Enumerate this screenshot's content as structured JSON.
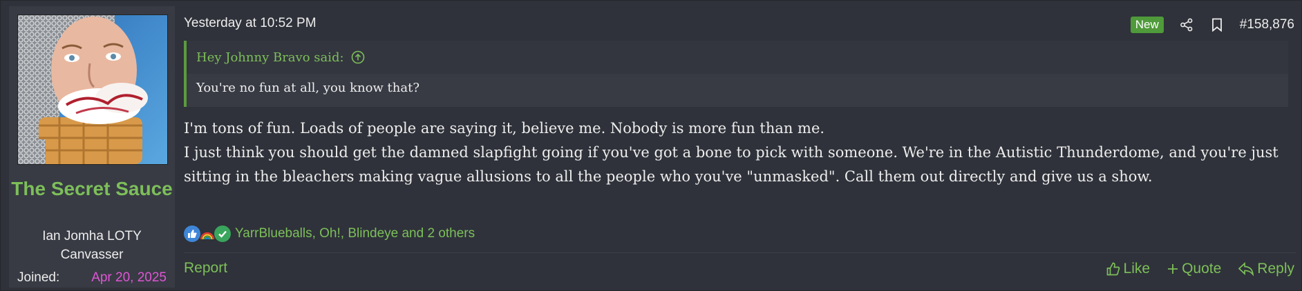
{
  "user": {
    "name": "The Secret Sauce",
    "title_line1": "Ian Jomha LOTY",
    "title_line2": "Canvasser",
    "joined_label": "Joined:",
    "joined_value": "Apr 20, 2025"
  },
  "post": {
    "date": "Yesterday at 10:52 PM",
    "new_badge": "New",
    "number": "#158,876",
    "quote": {
      "author_line": "Hey Johnny Bravo said:",
      "text": "You're no fun at all, you know that?"
    },
    "body": [
      "I'm tons of fun. Loads of people are saying it, believe me. Nobody is more fun than me.",
      "I just think you should get the damned slapfight going if you've got a bone to pick with someone. We're in the Autistic Thunderdome, and you're just sitting in the bleachers making vague allusions to all the people who you've \"unmasked\". Call them out directly and give us a show."
    ],
    "reactions": {
      "icons": [
        "thumbs-up-icon",
        "rainbow-icon",
        "checkmark-icon"
      ],
      "users_text": "YarrBlueballs, Oh!, Blindeye and 2 others"
    }
  },
  "footer": {
    "report": "Report",
    "like": "Like",
    "quote": "Quote",
    "reply": "Reply"
  },
  "colors": {
    "accent_green": "#7dbf5a",
    "join_date_pink": "#e055d6",
    "background": "#2f323a"
  }
}
